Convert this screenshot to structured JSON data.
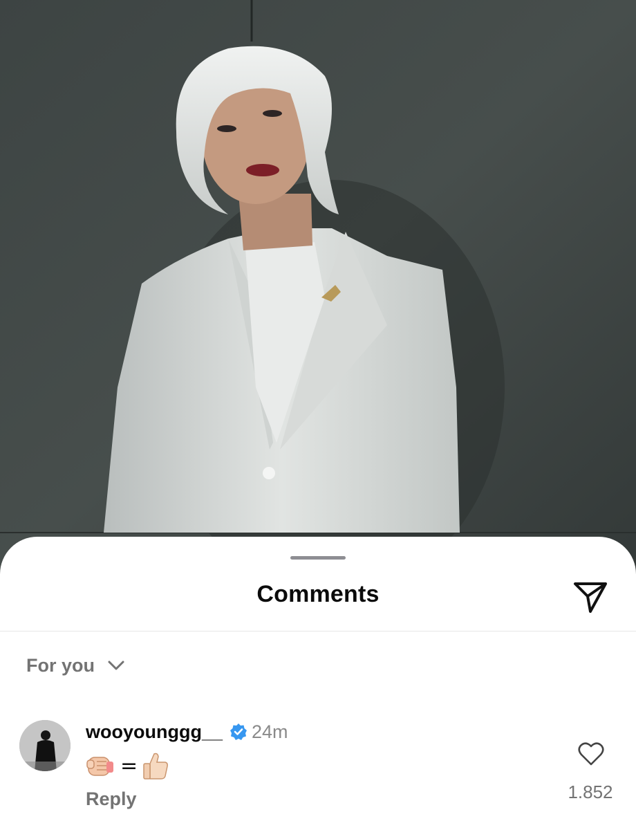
{
  "sheet": {
    "title": "Comments",
    "share_icon": "send-icon",
    "grabber_icon": "grabber-handle"
  },
  "filter": {
    "label": "For you",
    "icon": "chevron-down-icon"
  },
  "comment": {
    "username": "wooyounggg__",
    "verified": true,
    "time": "24m",
    "text_glyphs": [
      "fist-icon",
      "=",
      "thumbs-up-icon"
    ],
    "equals": "=",
    "reply_label": "Reply",
    "like_count": "1.852",
    "like_icon": "heart-icon"
  },
  "colors": {
    "verified_blue": "#3797f0",
    "secondary_text": "#737373",
    "primary_text": "#0b0b0b"
  }
}
